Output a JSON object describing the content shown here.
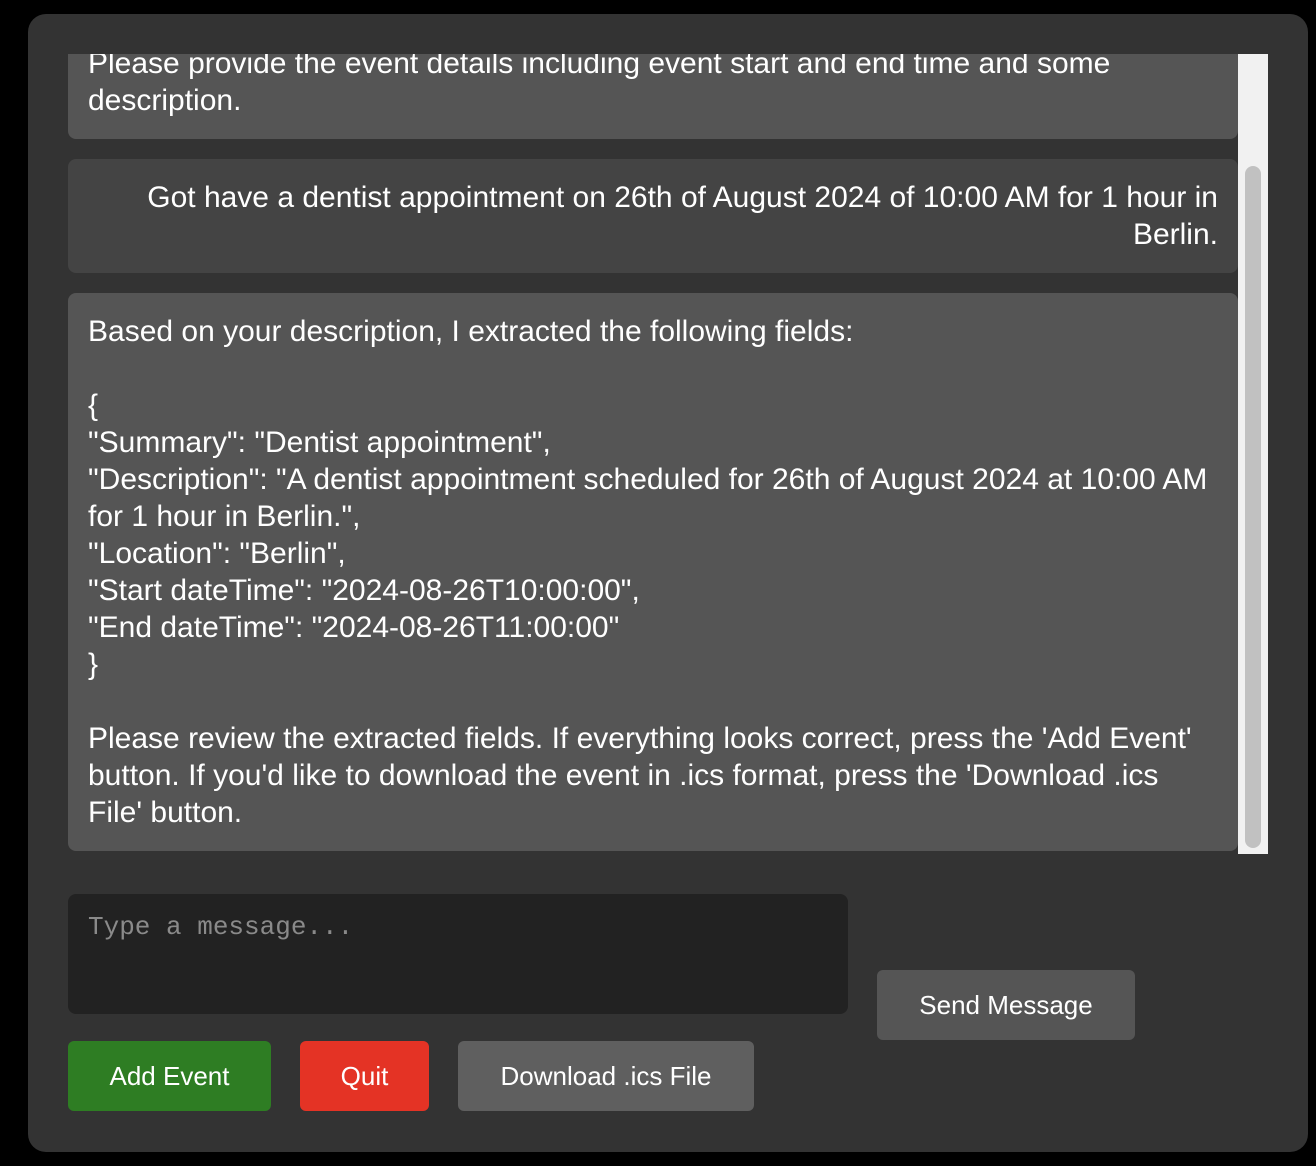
{
  "messages": [
    {
      "role": "bot",
      "text": "Please provide the event details including event start and end time and some description."
    },
    {
      "role": "user",
      "text": "Got have a dentist appointment on 26th of August 2024 of 10:00 AM for 1 hour in Berlin."
    },
    {
      "role": "bot",
      "text": "Based on your description, I extracted the following fields:\n\n{\n\"Summary\": \"Dentist appointment\",\n\"Description\": \"A dentist appointment scheduled for 26th of August 2024 at 10:00 AM for 1 hour in Berlin.\",\n\"Location\": \"Berlin\",\n\"Start dateTime\": \"2024-08-26T10:00:00\",\n\"End dateTime\": \"2024-08-26T11:00:00\"\n}\n\nPlease review the extracted fields. If everything looks correct, press the 'Add Event' button. If you'd like to download the event in .ics format, press the 'Download .ics File' button."
    }
  ],
  "input": {
    "placeholder": "Type a message...",
    "value": ""
  },
  "buttons": {
    "send": "Send Message",
    "add_event": "Add Event",
    "quit": "Quit",
    "download": "Download .ics File"
  },
  "colors": {
    "background": "#333333",
    "bot_bubble": "#555555",
    "user_bubble": "#444444",
    "add_event": "#2e7d23",
    "quit": "#e43325",
    "neutral_button": "#555555"
  }
}
